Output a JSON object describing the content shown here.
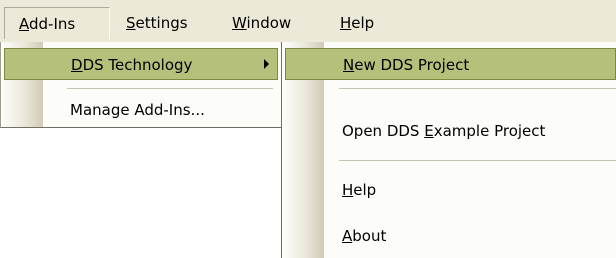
{
  "menubar": {
    "items": [
      {
        "prefix": "",
        "accel": "A",
        "rest": "dd-Ins"
      },
      {
        "prefix": "",
        "accel": "S",
        "rest": "ettings"
      },
      {
        "prefix": "",
        "accel": "W",
        "rest": "indow"
      },
      {
        "prefix": "",
        "accel": "H",
        "rest": "elp"
      }
    ]
  },
  "addins_menu": {
    "dds_technology": {
      "accel": "D",
      "rest": "DS Technology"
    },
    "manage_addins": "Manage Add-Ins..."
  },
  "dds_submenu": {
    "new_project": {
      "accel": "N",
      "rest": "ew DDS Project"
    },
    "open_example": {
      "prefix": "Open DDS ",
      "accel": "E",
      "rest": "xample Project"
    },
    "help": {
      "accel": "H",
      "rest": "elp"
    },
    "about": {
      "accel": "A",
      "rest": "bout"
    }
  },
  "colors": {
    "menubar_bg": "#ece9d8",
    "highlight": "#b5c07b",
    "highlight_border": "#7b8a3f"
  }
}
